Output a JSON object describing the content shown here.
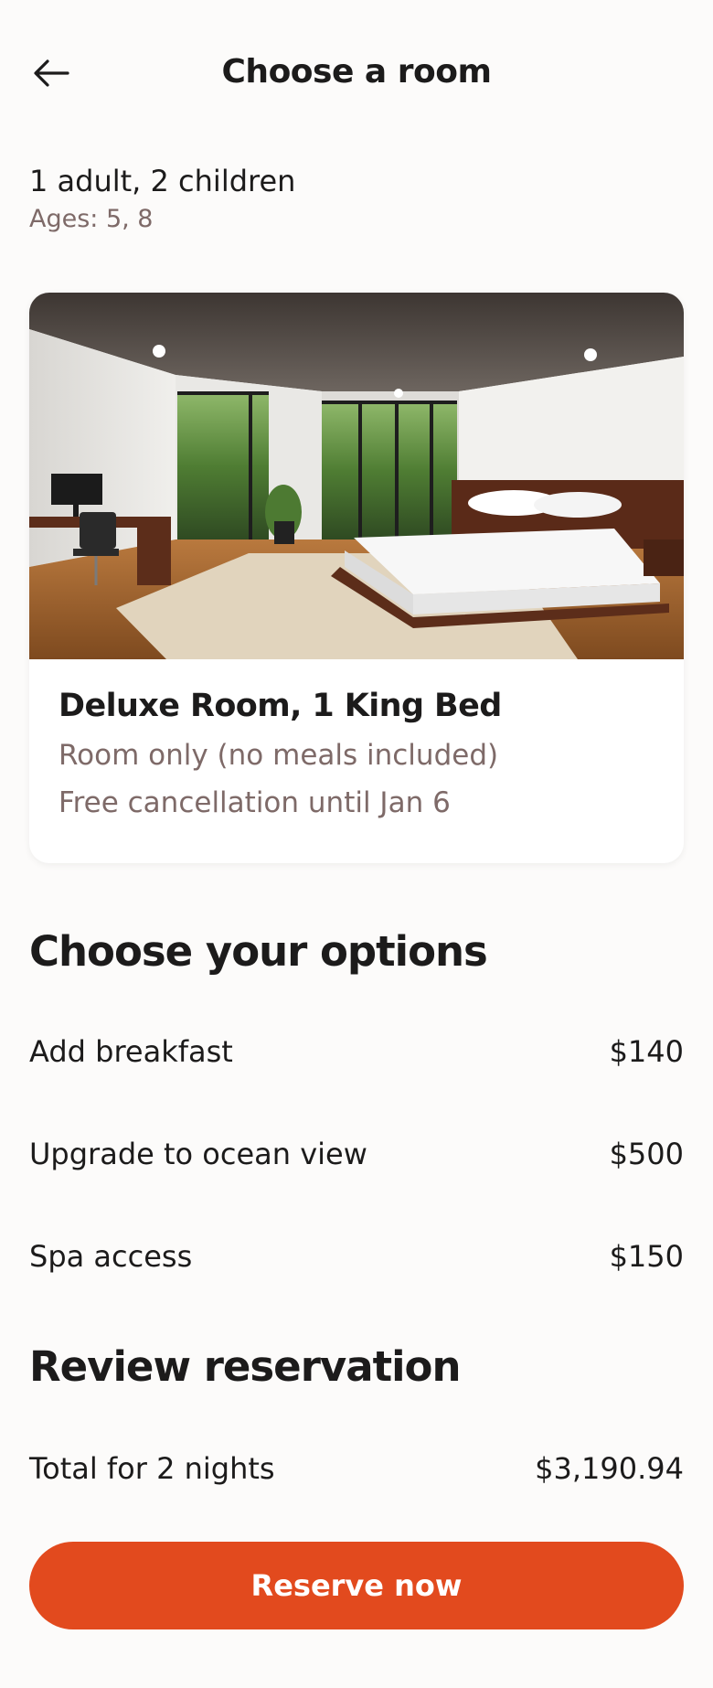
{
  "header": {
    "title": "Choose a room",
    "back_icon": "arrow-left-icon"
  },
  "guests": {
    "summary": "1 adult, 2 children",
    "ages": "Ages: 5, 8"
  },
  "room": {
    "name": "Deluxe Room, 1 King Bed",
    "meal_plan": "Room only (no meals included)",
    "cancellation": "Free cancellation until Jan 6"
  },
  "options": {
    "title": "Choose your options",
    "items": [
      {
        "label": "Add breakfast",
        "price": "$140"
      },
      {
        "label": "Upgrade to ocean view",
        "price": "$500"
      },
      {
        "label": "Spa access",
        "price": "$150"
      }
    ]
  },
  "review": {
    "title": "Review reservation",
    "total_label": "Total for 2 nights",
    "total_value": "$3,190.94"
  },
  "cta": {
    "label": "Reserve now"
  },
  "colors": {
    "accent": "#e24a1e",
    "muted_text": "#7e6a68"
  }
}
